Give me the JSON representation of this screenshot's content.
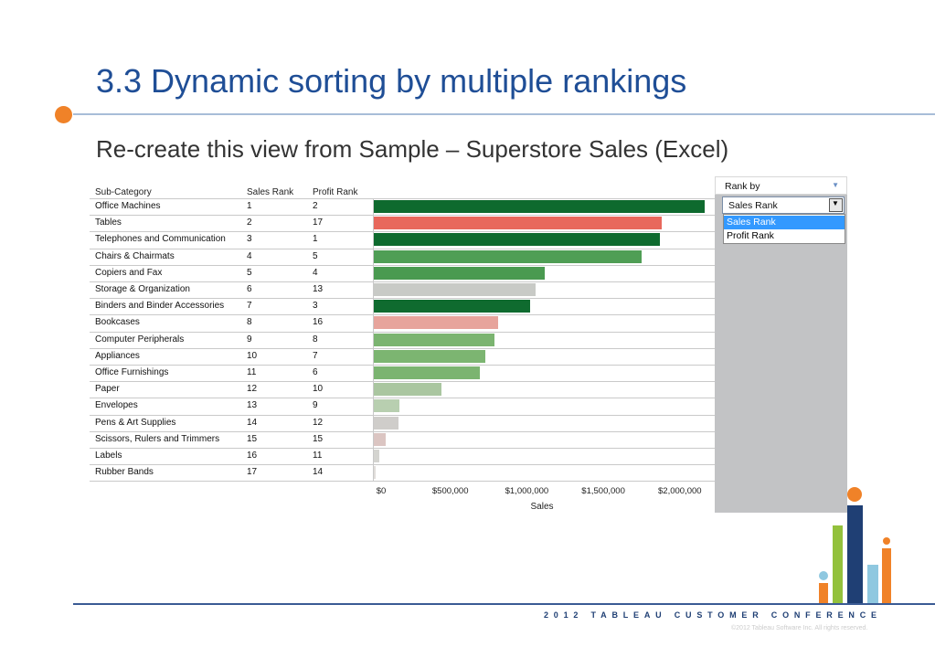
{
  "slide": {
    "title": "3.3 Dynamic sorting by multiple rankings",
    "subtitle": "Re-create this view from Sample – Superstore Sales (Excel)",
    "conference": "2012 TABLEAU CUSTOMER CONFERENCE",
    "copyright": "©2012 Tableau Software Inc. All rights reserved."
  },
  "colors": {
    "title": "#1f4e96",
    "accent_orange": "#f08228"
  },
  "table": {
    "headers": [
      "Sub-Category",
      "Sales Rank",
      "Profit Rank"
    ]
  },
  "panel": {
    "title": "Rank by",
    "selected": "Sales Rank",
    "options": [
      "Sales Rank",
      "Profit Rank"
    ]
  },
  "chart_data": {
    "type": "bar",
    "orientation": "horizontal",
    "xlabel": "Sales",
    "xlim": [
      0,
      2300000
    ],
    "x_ticks": [
      0,
      500000,
      1000000,
      1500000,
      2000000
    ],
    "x_tick_labels": [
      "$0",
      "$500,000",
      "$1,000,000",
      "$1,500,000",
      "$2,000,000"
    ],
    "categories": [
      "Office Machines",
      "Tables",
      "Telephones and Communication",
      "Chairs & Chairmats",
      "Copiers and Fax",
      "Storage & Organization",
      "Binders and Binder Accessories",
      "Bookcases",
      "Computer Peripherals",
      "Appliances",
      "Office Furnishings",
      "Paper",
      "Envelopes",
      "Pens & Art Supplies",
      "Scissors, Rulers and Trimmers",
      "Labels",
      "Rubber Bands"
    ],
    "sales_rank": [
      1,
      2,
      3,
      4,
      5,
      6,
      7,
      8,
      9,
      10,
      11,
      12,
      13,
      14,
      15,
      16,
      17
    ],
    "profit_rank": [
      2,
      17,
      1,
      5,
      4,
      13,
      3,
      16,
      8,
      7,
      6,
      10,
      9,
      12,
      15,
      11,
      14
    ],
    "values": [
      2160000,
      1880000,
      1870000,
      1750000,
      1120000,
      1060000,
      1020000,
      810000,
      790000,
      730000,
      690000,
      440000,
      170000,
      160000,
      80000,
      35000,
      12000
    ],
    "bar_colors": [
      "#0e6a2e",
      "#e8685c",
      "#0e6a2e",
      "#4f9e55",
      "#4a9a50",
      "#c8cac6",
      "#0f6b2f",
      "#e7a49c",
      "#7bb470",
      "#7cb571",
      "#7bb470",
      "#aac6a0",
      "#b8cfb0",
      "#cfcdca",
      "#dbc5c2",
      "#d4d4d0",
      "#e0ddda"
    ]
  }
}
